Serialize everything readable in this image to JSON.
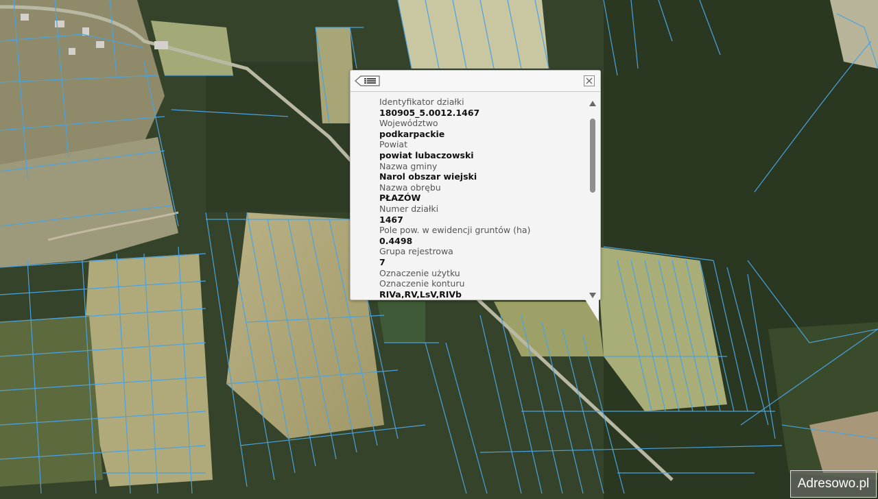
{
  "popup": {
    "fields": [
      {
        "label": "Identyfikator działki",
        "value": "180905_5.0012.1467"
      },
      {
        "label": "Województwo",
        "value": "podkarpackie"
      },
      {
        "label": "Powiat",
        "value": "powiat lubaczowski"
      },
      {
        "label": "Nazwa gminy",
        "value": "Narol obszar wiejski"
      },
      {
        "label": "Nazwa obrębu",
        "value": "PŁAZÓW"
      },
      {
        "label": "Numer działki",
        "value": "1467"
      },
      {
        "label": "Pole pow. w ewidencji gruntów (ha)",
        "value": "0.4498"
      },
      {
        "label": "Grupa rejestrowa",
        "value": "7"
      },
      {
        "label": "Oznaczenie użytku",
        "value": ""
      },
      {
        "label": "Oznaczenie konturu",
        "value": "RIVa,RV,LsV,RIVb"
      }
    ],
    "back_icon": "back-list-icon",
    "close_icon": "close-icon"
  },
  "watermark": {
    "text": "Adresowo.pl"
  },
  "colors": {
    "parcel_lines": "#4aa3e0",
    "forest": "#2f3d24",
    "field": "#b8b07e"
  }
}
